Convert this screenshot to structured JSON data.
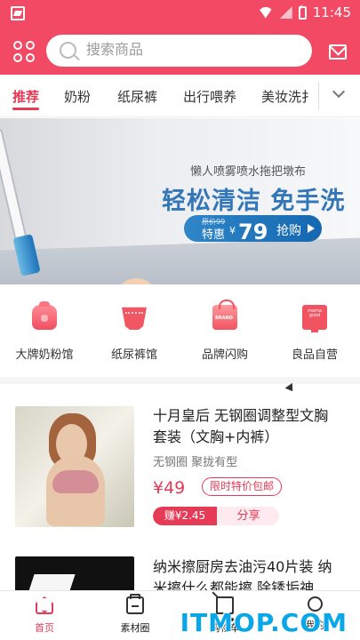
{
  "status_bar": {
    "time": "11:45",
    "icons": [
      "app-icon",
      "wifi-icon",
      "signal-icon",
      "battery-icon"
    ]
  },
  "header": {
    "search_placeholder": "搜索商品",
    "icons": [
      "grid-menu-icon",
      "search-icon",
      "message-icon"
    ],
    "colors": {
      "brand": "#f24a64",
      "accent": "#e53b57"
    }
  },
  "tabs": {
    "items": [
      {
        "label": "推荐",
        "active": true
      },
      {
        "label": "奶粉",
        "active": false
      },
      {
        "label": "纸尿裤",
        "active": false
      },
      {
        "label": "出行喂养",
        "active": false
      },
      {
        "label": "美妆洗扌",
        "active": false
      }
    ]
  },
  "banner": {
    "small_text": "懒人喷雾喷水拖把墩布",
    "title": "轻松清洁 免手洗",
    "old_price": "原价99",
    "special_label": "特惠",
    "currency": "¥",
    "price": "79",
    "buy_label": "抢购",
    "slides_total": 3,
    "active_slide": 1
  },
  "categories": [
    {
      "label": "大牌奶粉馆",
      "icon": "milk-bottle-icon"
    },
    {
      "label": "纸尿裤馆",
      "icon": "diaper-icon"
    },
    {
      "label": "品牌闪购",
      "icon": "brand-bag-icon"
    },
    {
      "label": "良品自营",
      "icon": "store-screen-icon"
    }
  ],
  "products": [
    {
      "title": "十月皇后 无钢圈调整型文胸套装（文胸+内裤）",
      "subtitle": "无钢圈 聚拢有型",
      "price": "¥49",
      "badge": "限时特价包邮",
      "earn": "赚¥2.45",
      "share": "分享"
    },
    {
      "title": "纳米擦厨房去油污40片装 纳米擦什么都能擦 除锈垢神..."
    }
  ],
  "bottom_nav": [
    {
      "label": "首页",
      "icon": "home-icon",
      "active": true
    },
    {
      "label": "素材圈",
      "icon": "material-icon",
      "active": false
    },
    {
      "label": "购物车",
      "icon": "cart-icon",
      "active": false
    },
    {
      "label": "我的",
      "icon": "profile-icon",
      "active": false
    }
  ],
  "watermark": "ITMOP.COM"
}
